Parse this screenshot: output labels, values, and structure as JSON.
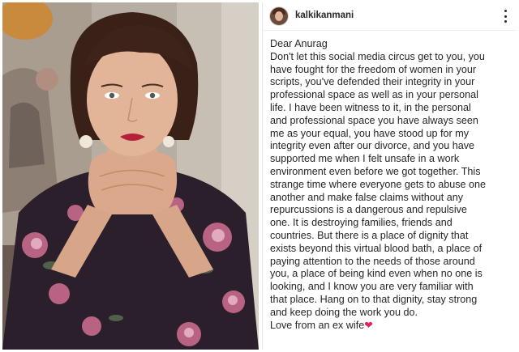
{
  "post": {
    "username": "kalkikanmani",
    "caption_lines": [
      "Dear Anurag",
      "Don't let this social media circus get to you, you",
      "have fought for the freedom of women in your",
      "scripts, you've defended their integrity in your",
      "professional space as well as in your personal",
      "life. I have been witness to it, in the personal",
      "and professional space you have always seen",
      "me as your equal, you have stood up for my",
      "integrity even after our divorce, and you have",
      "supported me when I felt unsafe in a work",
      "environment even before we got together. This",
      "strange time where everyone gets to abuse one",
      "another and make false claims without any",
      "repurcussions is a dangerous and repulsive",
      "one. It is destroying families, friends and",
      "countries. But there is a place of dignity that",
      "exists beyond this virtual blood bath, a place of",
      "paying attention to the needs of those around",
      "you, a place of being kind even when no one is",
      "looking, and I know you are very familiar with",
      "that place. Hang on to that dignity, stay strong",
      "and keep doing the work you do."
    ],
    "sign_off": "Love from an ex wife",
    "heart": "❤"
  },
  "icons": {
    "more": "more-options-icon",
    "heart_color": "#e0245e"
  }
}
